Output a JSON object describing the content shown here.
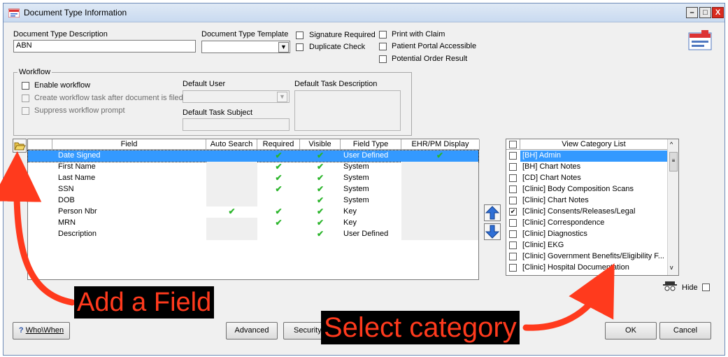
{
  "window": {
    "title": "Document Type Information",
    "buttons": [
      "–",
      "□",
      "X"
    ]
  },
  "form": {
    "description_label": "Document Type Description",
    "description_value": "ABN",
    "template_label": "Document Type Template",
    "signature_required": "Signature Required",
    "duplicate_check": "Duplicate Check",
    "print_with_claim": "Print with Claim",
    "patient_portal": "Patient Portal Accessible",
    "potential_order": "Potential Order Result"
  },
  "workflow": {
    "group_label": "Workflow",
    "enable": "Enable workflow",
    "create_task": "Create workflow task after document is filed",
    "suppress": "Suppress workflow prompt",
    "default_user": "Default User",
    "default_task_subject": "Default Task Subject",
    "default_task_description": "Default Task Description"
  },
  "fields_grid": {
    "columns": [
      "Field",
      "Auto Search",
      "Required",
      "Visible",
      "Field Type",
      "EHR/PM Display"
    ],
    "rows": [
      {
        "field": "Date Signed",
        "auto": "",
        "required": "✔",
        "visible": "✔",
        "type": "User Defined",
        "ehr": "✔"
      },
      {
        "field": "First Name",
        "auto": "",
        "required": "✔",
        "visible": "✔",
        "type": "System",
        "ehr": ""
      },
      {
        "field": "Last Name",
        "auto": "",
        "required": "✔",
        "visible": "✔",
        "type": "System",
        "ehr": ""
      },
      {
        "field": "SSN",
        "auto": "",
        "required": "✔",
        "visible": "✔",
        "type": "System",
        "ehr": ""
      },
      {
        "field": "DOB",
        "auto": "",
        "required": "",
        "visible": "✔",
        "type": "System",
        "ehr": ""
      },
      {
        "field": "Person Nbr",
        "auto": "✔",
        "required": "✔",
        "visible": "✔",
        "type": "Key",
        "ehr": ""
      },
      {
        "field": "MRN",
        "auto": "",
        "required": "✔",
        "visible": "✔",
        "type": "Key",
        "ehr": ""
      },
      {
        "field": "Description",
        "auto": "",
        "required": "",
        "visible": "✔",
        "type": "User Defined",
        "ehr": ""
      }
    ]
  },
  "category_list": {
    "header": "View Category List",
    "items": [
      {
        "label": "[BH] Admin",
        "checked": false,
        "selected": true
      },
      {
        "label": "[BH] Chart Notes",
        "checked": false,
        "selected": false
      },
      {
        "label": "[CD] Chart Notes",
        "checked": false,
        "selected": false
      },
      {
        "label": "[Clinic] Body Composition Scans",
        "checked": false,
        "selected": false
      },
      {
        "label": "[Clinic] Chart Notes",
        "checked": false,
        "selected": false
      },
      {
        "label": "[Clinic] Consents/Releases/Legal",
        "checked": true,
        "selected": false
      },
      {
        "label": "[Clinic] Correspondence",
        "checked": false,
        "selected": false
      },
      {
        "label": "[Clinic] Diagnostics",
        "checked": false,
        "selected": false
      },
      {
        "label": "[Clinic] EKG",
        "checked": false,
        "selected": false
      },
      {
        "label": "[Clinic] Government Benefits/Eligibility F...",
        "checked": false,
        "selected": false
      },
      {
        "label": "[Clinic] Hospital Documentation",
        "checked": false,
        "selected": false
      }
    ],
    "hide_label": "Hide"
  },
  "footer": {
    "whowhen": "Who\\When",
    "advanced": "Advanced",
    "security": "Security",
    "ok": "OK",
    "cancel": "Cancel"
  },
  "annotations": {
    "add_field": "Add a Field",
    "select_category": "Select category",
    "color": "#ff3a1d"
  },
  "colors": {
    "selection": "#3399ff",
    "check": "#2bb52b"
  }
}
